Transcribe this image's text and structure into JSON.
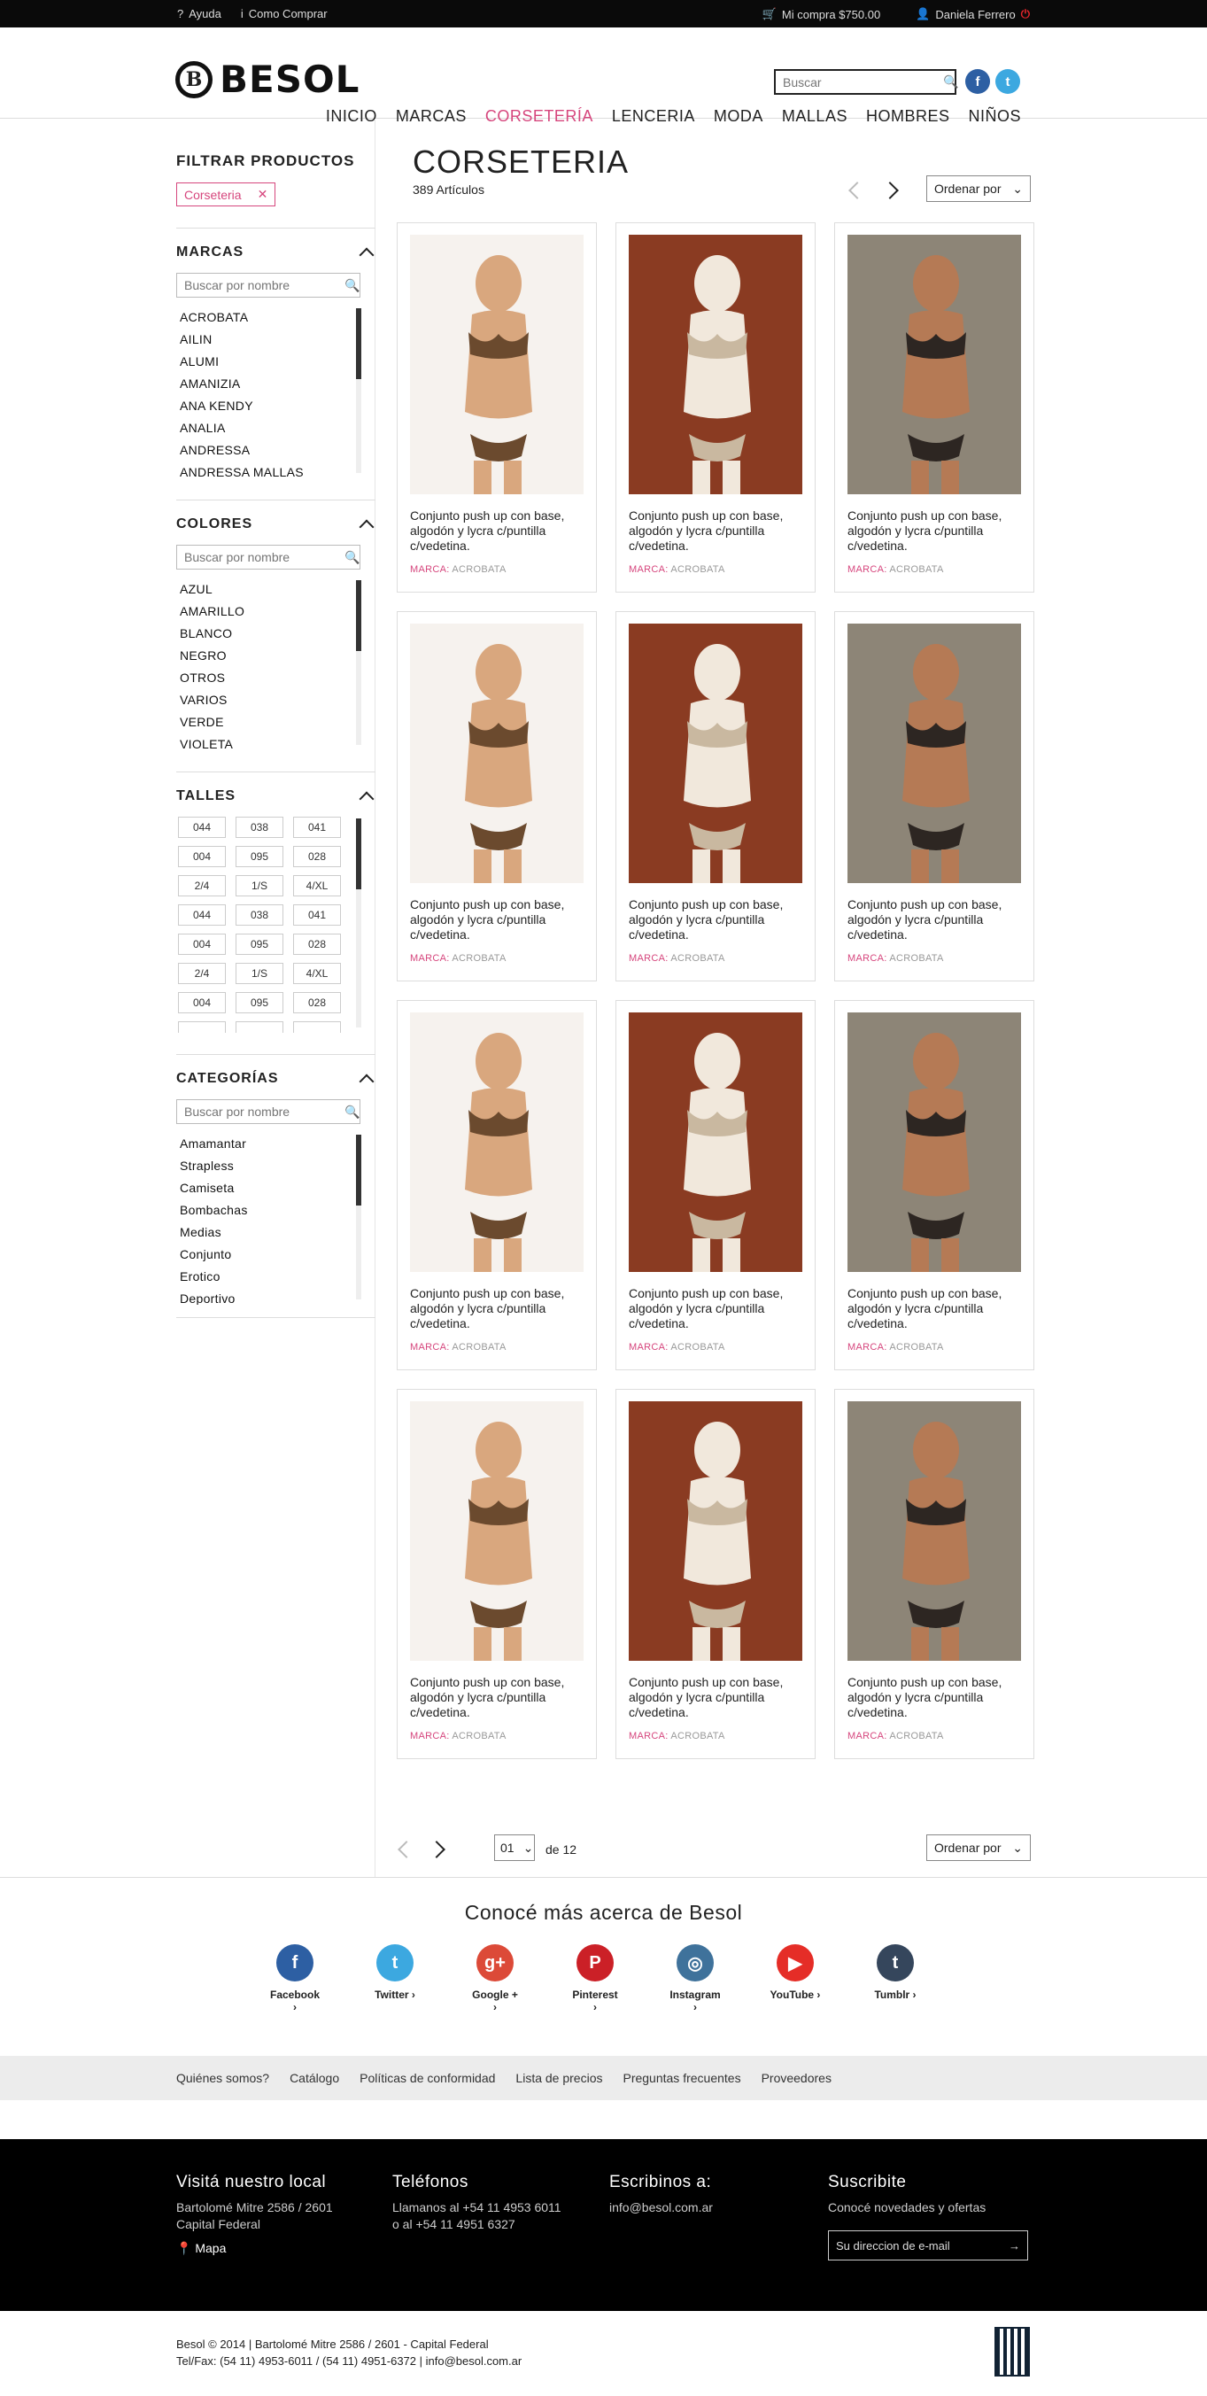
{
  "topbar": {
    "help": "Ayuda",
    "how": "Como Comprar",
    "cart": "Mi compra $750.00",
    "user": "Daniela Ferrero"
  },
  "header": {
    "logo": "BESOL",
    "logo_letter": "B",
    "search_placeholder": "Buscar",
    "nav": [
      "INICIO",
      "MARCAS",
      "CORSETERÍA",
      "LENCERIA",
      "MODA",
      "MALLAS",
      "HOMBRES",
      "NIÑOS"
    ],
    "active_nav": "CORSETERÍA"
  },
  "sidebar": {
    "title": "FILTRAR PRODUCTOS",
    "active_filter": "Corseteria",
    "brands": {
      "title": "MARCAS",
      "placeholder": "Buscar por nombre",
      "items": [
        "ACROBATA",
        "AILIN",
        "ALUMI",
        "AMANIZIA",
        "ANA KENDY",
        "ANALIA",
        "ANDRESSA",
        "ANDRESSA MALLAS"
      ]
    },
    "colors": {
      "title": "COLORES",
      "placeholder": "Buscar por nombre",
      "items": [
        "AZUL",
        "AMARILLO",
        "BLANCO",
        "NEGRO",
        "OTROS",
        "VARIOS",
        "VERDE",
        "VIOLETA"
      ]
    },
    "sizes": {
      "title": "TALLES",
      "items": [
        "044",
        "038",
        "041",
        "004",
        "095",
        "028",
        "2/4",
        "1/S",
        "4/XL",
        "044",
        "038",
        "041",
        "004",
        "095",
        "028",
        "2/4",
        "1/S",
        "4/XL",
        "004",
        "095",
        "028",
        "",
        "",
        ""
      ]
    },
    "categories": {
      "title": "CATEGORÍAS",
      "placeholder": "Buscar por nombre",
      "items": [
        "Amamantar",
        "Strapless",
        "Camiseta",
        "Bombachas",
        "Medias",
        "Conjunto",
        "Erotico",
        "Deportivo"
      ]
    }
  },
  "main": {
    "title": "CORSETERIA",
    "count": "389 Artículos",
    "sort_label": "Ordenar por",
    "products": [
      {
        "desc": "Conjunto push up con base, algodón y lycra c/puntilla c/vedetina.",
        "brand_key": "MARCA:",
        "brand": "ACROBATA"
      },
      {
        "desc": "Conjunto push up con base, algodón y lycra c/puntilla c/vedetina.",
        "brand_key": "MARCA:",
        "brand": "ACROBATA"
      },
      {
        "desc": "Conjunto push up con base, algodón y lycra c/puntilla c/vedetina.",
        "brand_key": "MARCA:",
        "brand": "ACROBATA"
      },
      {
        "desc": "Conjunto push up con base, algodón y lycra c/puntilla c/vedetina.",
        "brand_key": "MARCA:",
        "brand": "ACROBATA"
      },
      {
        "desc": "Conjunto push up con base, algodón y lycra c/puntilla c/vedetina.",
        "brand_key": "MARCA:",
        "brand": "ACROBATA"
      },
      {
        "desc": "Conjunto push up con base, algodón y lycra c/puntilla c/vedetina.",
        "brand_key": "MARCA:",
        "brand": "ACROBATA"
      },
      {
        "desc": "Conjunto push up con base, algodón y lycra c/puntilla c/vedetina.",
        "brand_key": "MARCA:",
        "brand": "ACROBATA"
      },
      {
        "desc": "Conjunto push up con base, algodón y lycra c/puntilla c/vedetina.",
        "brand_key": "MARCA:",
        "brand": "ACROBATA"
      },
      {
        "desc": "Conjunto push up con base, algodón y lycra c/puntilla c/vedetina.",
        "brand_key": "MARCA:",
        "brand": "ACROBATA"
      },
      {
        "desc": "Conjunto push up con base, algodón y lycra c/puntilla c/vedetina.",
        "brand_key": "MARCA:",
        "brand": "ACROBATA"
      },
      {
        "desc": "Conjunto push up con base, algodón y lycra c/puntilla c/vedetina.",
        "brand_key": "MARCA:",
        "brand": "ACROBATA"
      },
      {
        "desc": "Conjunto push up con base, algodón y lycra c/puntilla c/vedetina.",
        "brand_key": "MARCA:",
        "brand": "ACROBATA"
      }
    ],
    "pager": {
      "page": "01",
      "of": "de 12"
    }
  },
  "about": {
    "title": "Conocé más acerca de Besol",
    "networks": [
      {
        "label": "Facebook ›",
        "glyph": "f",
        "color": "#2d5fa3"
      },
      {
        "label": "Twitter ›",
        "glyph": "t",
        "color": "#3ca8e0"
      },
      {
        "label": "Google + ›",
        "glyph": "g+",
        "color": "#dc4a38"
      },
      {
        "label": "Pinterest ›",
        "glyph": "P",
        "color": "#cb2027"
      },
      {
        "label": "Instagram ›",
        "glyph": "◎",
        "color": "#3f729b"
      },
      {
        "label": "YouTube ›",
        "glyph": "▶",
        "color": "#e52d27"
      },
      {
        "label": "Tumblr ›",
        "glyph": "t",
        "color": "#35465c"
      }
    ]
  },
  "footer_links": [
    "Quiénes somos?",
    "Catálogo",
    "Políticas de conformidad",
    "Lista de precios",
    "Preguntas frecuentes",
    "Proveedores"
  ],
  "footer": {
    "visit_title": "Visitá nuestro local",
    "address1": "Bartolomé Mitre 2586 / 2601",
    "address2": "Capital Federal",
    "map": "Mapa",
    "phones_title": "Teléfonos",
    "phone1": "Llamanos al +54 11 4953 6011",
    "phone2": "o al +54 11 4951 6327",
    "write_title": "Escribinos a:",
    "email": "info@besol.com.ar",
    "sub_title": "Suscribite",
    "sub_text": "Conocé novedades y ofertas",
    "sub_placeholder": "Su direccion de e-mail"
  },
  "copyright": {
    "line1": "Besol © 2014  |  Bartolomé Mitre 2586 / 2601 - Capital Federal",
    "line2": "Tel/Fax: (54 11) 4953-6011 / (54 11) 4951-6372  |  info@besol.com.ar"
  },
  "colors": {
    "accent": "#d6467d",
    "facebook": "#2d5fa3",
    "twitter": "#3ca8e0",
    "power": "#e4252b"
  }
}
